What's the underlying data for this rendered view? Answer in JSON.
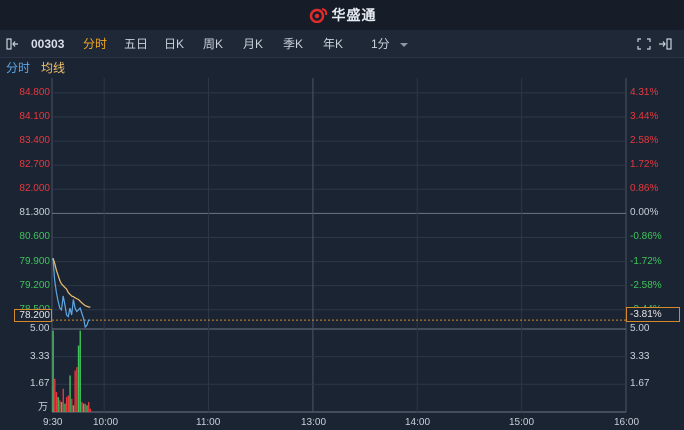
{
  "header": {
    "app_name": "华盛通"
  },
  "toolbar": {
    "stock_code": "00303",
    "tabs": [
      "分时",
      "五日",
      "日K",
      "周K",
      "月K",
      "季K",
      "年K"
    ],
    "active_tab": "分时",
    "interval": "1分"
  },
  "subbar": {
    "item_a": "分时",
    "item_b": "均线"
  },
  "colors": {
    "up": "#e8383d",
    "down": "#3fc35b",
    "neutral": "#c9d1dc",
    "price_line": "#5ea7e6",
    "avg_line": "#f0c070",
    "accent": "#f5a623"
  },
  "chart_data": {
    "type": "line",
    "prev_close": 81.3,
    "last_price": 78.2,
    "last_change_pct": "-3.81%",
    "price_ticks": [
      "84.800",
      "84.100",
      "83.400",
      "82.700",
      "82.000",
      "81.300",
      "80.600",
      "79.900",
      "79.200",
      "78.500"
    ],
    "pct_ticks": [
      "4.31%",
      "3.44%",
      "2.58%",
      "1.72%",
      "0.86%",
      "0.00%",
      "-0.86%",
      "-1.72%",
      "-2.58%",
      "-3.44%"
    ],
    "last_price_label": "78.200",
    "ylim": [
      78.0,
      85.0
    ],
    "x_ticks": [
      "9:30",
      "10:00",
      "11:00",
      "13:00",
      "14:00",
      "15:00",
      "16:00"
    ],
    "volume_ticks": [
      "5.00",
      "3.33",
      "1.67"
    ],
    "volume_unit": "万",
    "series": [
      {
        "name": "分时",
        "values": [
          80.0,
          79.35,
          79.0,
          78.75,
          78.55,
          78.5,
          78.9,
          78.65,
          78.35,
          78.3,
          78.55,
          78.35,
          78.8,
          78.55,
          78.45,
          78.5,
          78.55,
          78.4,
          78.25,
          78.0,
          78.05,
          78.2,
          78.2
        ]
      },
      {
        "name": "均线",
        "values": [
          80.0,
          79.85,
          79.65,
          79.5,
          79.35,
          79.25,
          79.2,
          79.15,
          79.1,
          79.0,
          78.95,
          78.9,
          78.88,
          78.85,
          78.82,
          78.8,
          78.75,
          78.7,
          78.66,
          78.62,
          78.6,
          78.58,
          78.58
        ]
      }
    ],
    "volume": {
      "values": [
        4.9,
        2.0,
        1.2,
        0.9,
        0.7,
        0.6,
        1.4,
        0.5,
        0.9,
        1.0,
        2.2,
        0.8,
        0.4,
        2.5,
        2.7,
        4.0,
        4.9,
        0.6,
        0.5,
        0.5,
        0.4,
        0.6,
        0.2
      ],
      "directions": [
        "down",
        "up",
        "up",
        "down",
        "up",
        "down",
        "up",
        "down",
        "up",
        "up",
        "down",
        "up",
        "down",
        "up",
        "up",
        "down",
        "down",
        "up",
        "down",
        "up",
        "down",
        "up",
        "up"
      ]
    }
  }
}
